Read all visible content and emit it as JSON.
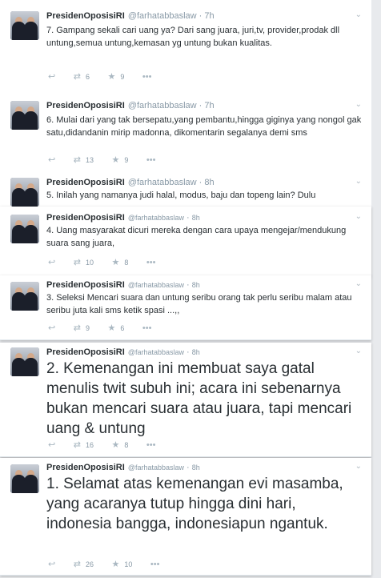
{
  "tweets": [
    {
      "name": "PresidenOposisiRI",
      "handle": "@farhatabbaslaw",
      "time": "7h",
      "text": "7. Gampang sekali cari uang ya? Dari sang juara, juri,tv, provider,prodak dll untung,semua untung,kemasan yg untung bukan kualitas.",
      "retweets": "6",
      "favorites": "9"
    },
    {
      "name": "PresidenOposisiRI",
      "handle": "@farhatabbaslaw",
      "time": "7h",
      "text": "6. Mulai dari yang tak bersepatu,yang pembantu,hingga giginya yang nongol gak satu,didandanin mirip madonna, dikomentarin segalanya demi sms",
      "retweets": "13",
      "favorites": "9"
    },
    {
      "name": "PresidenOposisiRI",
      "handle": "@farhatabbaslaw",
      "time": "8h",
      "text": "5. Inilah yang namanya judi halal, modus, baju dan topeng lain? Dulu",
      "retweets": "",
      "favorites": ""
    },
    {
      "name": "PresidenOposisiRI",
      "handle": "@farhatabbaslaw",
      "time": "8h",
      "text": "4. Uang masyarakat dicuri mereka dengan cara upaya mengejar/mendukung suara sang juara,",
      "retweets": "10",
      "favorites": "8"
    },
    {
      "name": "PresidenOposisiRI",
      "handle": "@farhatabbaslaw",
      "time": "8h",
      "text": "3. Seleksi Mencari suara dan untung seribu orang tak perlu seribu malam atau seribu juta kali sms ketik spasi ...,,",
      "retweets": "9",
      "favorites": "6"
    },
    {
      "name": "PresidenOposisiRI",
      "handle": "@farhatabbaslaw",
      "time": "8h",
      "text": "2. Kemenangan ini membuat saya gatal menulis twit subuh ini; acara ini sebenarnya bukan mencari suara atau juara, tapi mencari uang & untung",
      "retweets": "16",
      "favorites": "8"
    },
    {
      "name": "PresidenOposisiRI",
      "handle": "@farhatabbaslaw",
      "time": "8h",
      "text": "1. Selamat atas kemenangan evi masamba, yang acaranya tutup hingga dini hari, indonesia bangga, indonesiapun ngantuk.",
      "retweets": "26",
      "favorites": "10"
    }
  ],
  "icons": {
    "reply": "reply-icon",
    "retweet": "retweet-icon",
    "favorite": "star-icon",
    "more": "more-icon",
    "caret": "caret-icon"
  }
}
